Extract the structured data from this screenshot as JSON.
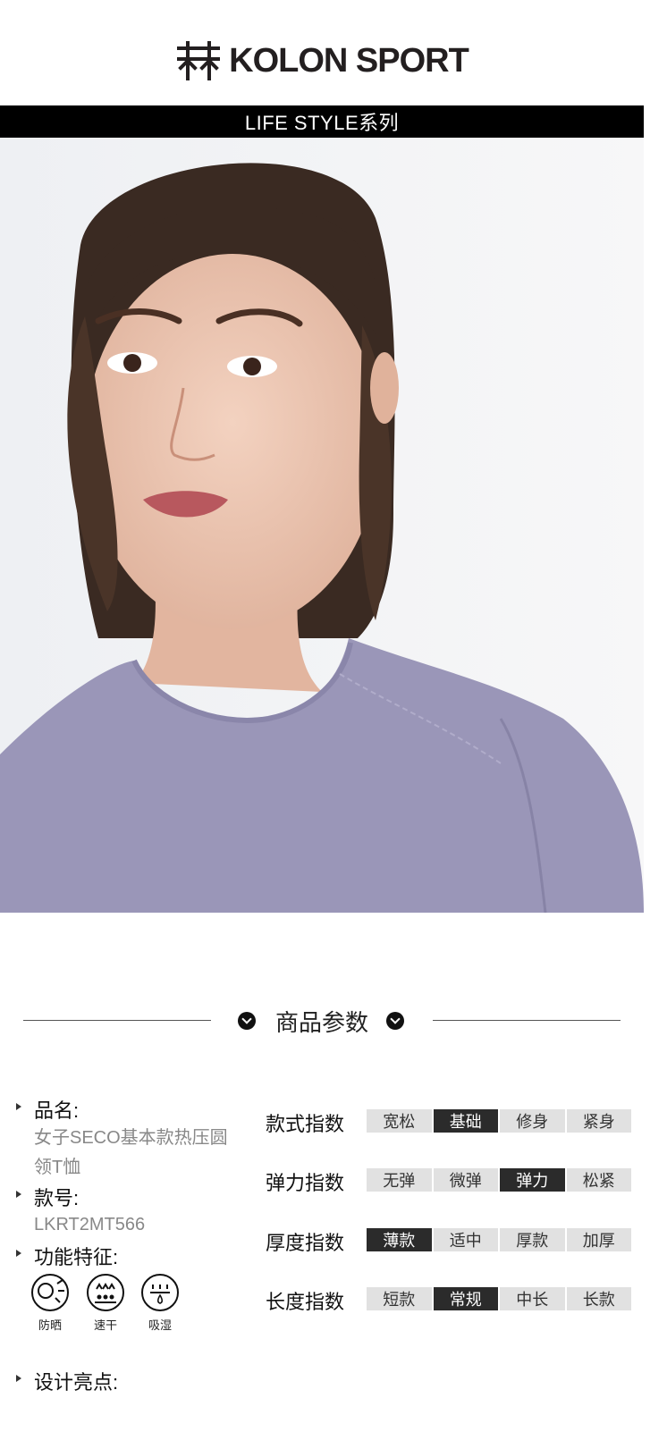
{
  "brand": {
    "name": "KOLON SPORT"
  },
  "series": "LIFE STYLE系列",
  "section_title": "商品参数",
  "info": {
    "name_label": "品名:",
    "name_value_line1": "女子SECO基本款热压圆",
    "name_value_line2": "领T恤",
    "model_label": "款号:",
    "model_value": "LKRT2MT566",
    "feature_label": "功能特征:",
    "features": [
      {
        "icon": "sun-protection-icon",
        "label": "防晒"
      },
      {
        "icon": "quick-dry-icon",
        "label": "速干"
      },
      {
        "icon": "moisture-wicking-icon",
        "label": "吸湿"
      }
    ],
    "highlights_label": "设计亮点:"
  },
  "indices": [
    {
      "label": "款式指数",
      "options": [
        "宽松",
        "基础",
        "修身",
        "紧身"
      ],
      "selected": 1
    },
    {
      "label": "弹力指数",
      "options": [
        "无弹",
        "微弹",
        "弹力",
        "松紧"
      ],
      "selected": 2
    },
    {
      "label": "厚度指数",
      "options": [
        "薄款",
        "适中",
        "厚款",
        "加厚"
      ],
      "selected": 0
    },
    {
      "label": "长度指数",
      "options": [
        "短款",
        "常规",
        "中长",
        "长款"
      ],
      "selected": 1
    }
  ],
  "colors": {
    "tshirt": "#9a96b8",
    "selected_cell": "#2b2b2b",
    "cell": "#e1e1e1"
  }
}
